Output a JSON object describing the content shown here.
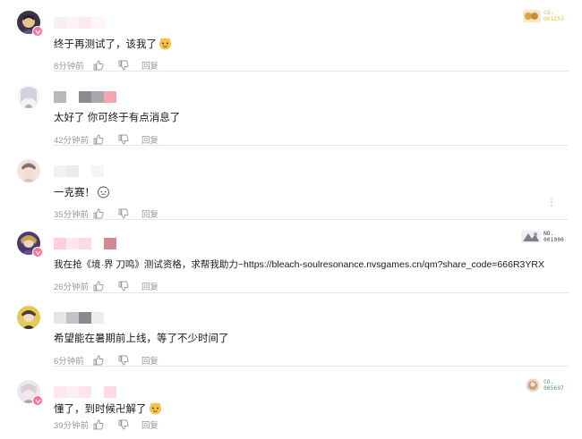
{
  "comments": [
    {
      "text": "终于再测试了，该我了",
      "emoji_icon": "cat-face-emoji",
      "time": "8分钟前",
      "reply_label": "回复",
      "fan_badge": {
        "prefix": "CO.",
        "number": "001251",
        "color": "#f2b33d"
      },
      "avatar_colors": [
        "#3b3245",
        "#e6c58a"
      ]
    },
    {
      "text": "太好了 你可终于有点消息了",
      "time": "42分钟前",
      "reply_label": "回复",
      "avatar_colors": [
        "#e8e8ec",
        "#b0aebd"
      ]
    },
    {
      "text": "一克赛！",
      "emoji_icon": "sweat-face-emoji",
      "time": "35分钟前",
      "reply_label": "回复",
      "more_icon": "⋮",
      "avatar_colors": [
        "#d9c3c0",
        "#8b6a70"
      ]
    },
    {
      "text": "我在抢《境·界 刀鸣》测试资格，求帮我助力~https://bleach-soulresonance.nvsgames.cn/qm?share_code=666R3YRX",
      "time": "26分钟前",
      "reply_label": "回复",
      "fan_badge": {
        "prefix": "NO.",
        "number": "001000",
        "color": "#3a3a3a"
      },
      "avatar_colors": [
        "#4a3a6e",
        "#c8a25a"
      ]
    },
    {
      "text": "希望能在暑期前上线，等了不少时间了",
      "time": "6分钟前",
      "reply_label": "回复",
      "avatar_colors": [
        "#e3c95a",
        "#4e3e2a"
      ]
    },
    {
      "text": "懂了，到时候卍解了",
      "emoji_icon": "cat-face-emoji",
      "time": "39分钟前",
      "reply_label": "回复",
      "fan_badge": {
        "prefix": "CO.",
        "number": "005697",
        "color": "#4a8aa8"
      },
      "avatar_colors": [
        "#efe6ee",
        "#b79fb7"
      ]
    }
  ]
}
